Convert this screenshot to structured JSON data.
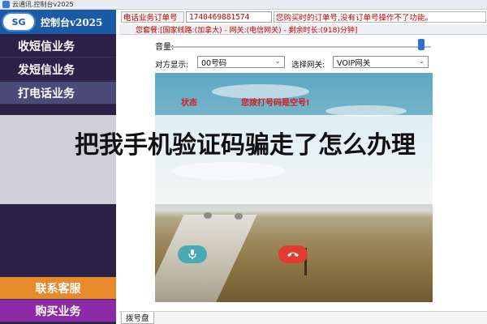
{
  "window": {
    "title": "云通讯.控制台v2025"
  },
  "sidebar": {
    "logo_badge": "SG",
    "logo_text": "控制台v2025",
    "items": [
      {
        "label": "收短信业务"
      },
      {
        "label": "发短信业务"
      },
      {
        "label": "打电话业务"
      }
    ],
    "contact_label": "联系客服",
    "buy_label": "购买业务"
  },
  "info": {
    "order_label": "电话业务订单号",
    "order_value": "1740469881574",
    "notice": "您购买时的订单号,没有订单号操作不了功能。",
    "package": "您套餐:[国家线路:(加拿大) - 网关:(电信网关) - 剩余时长:(918)分钟]"
  },
  "dial": {
    "volume_label": "音量:",
    "volume_level": 0.95,
    "show_label": "对方显示:",
    "show_value": "00号码",
    "gateway_label": "选择网关:",
    "gateway_value": "VOIP网关",
    "status_word": "状态",
    "status_msg": "您拨打号码是空号!"
  },
  "tabs": [
    {
      "label": "拨号盘"
    }
  ],
  "overlay": {
    "headline": "把我手机验证码骗走了怎么办理"
  },
  "colors": {
    "accent": "#d21f1f",
    "sidebar": "#2c2247",
    "contact": "#e88a2a",
    "buy": "#8b2ba8"
  }
}
